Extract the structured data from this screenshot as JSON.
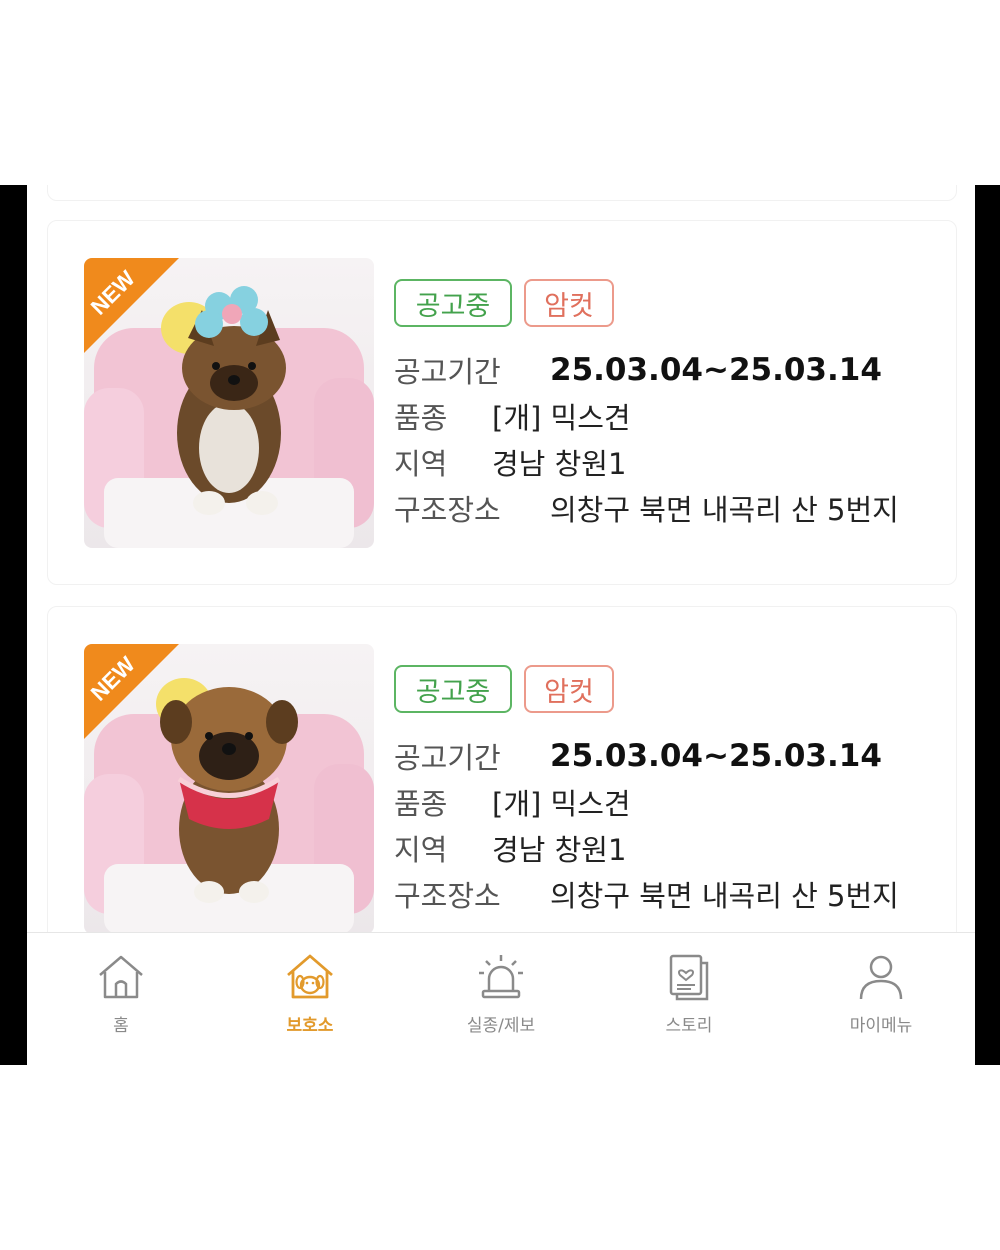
{
  "listings": [
    {
      "badge": "NEW",
      "status": "공고중",
      "sex": "암컷",
      "period_label": "공고기간",
      "period": "25.03.04~25.03.14",
      "breed_label": "품종",
      "breed": "[개] 믹스견",
      "region_label": "지역",
      "region": "경남 창원1",
      "place_label": "구조장소",
      "place": "의창구 북면 내곡리 산 5번지"
    },
    {
      "badge": "NEW",
      "status": "공고중",
      "sex": "암컷",
      "period_label": "공고기간",
      "period": "25.03.04~25.03.14",
      "breed_label": "품종",
      "breed": "[개] 믹스견",
      "region_label": "지역",
      "region": "경남 창원1",
      "place_label": "구조장소",
      "place": "의창구 북면 내곡리 산 5번지"
    }
  ],
  "nav": {
    "items": [
      {
        "label": "홈",
        "icon": "home-icon"
      },
      {
        "label": "보호소",
        "icon": "shelter-icon"
      },
      {
        "label": "실종/제보",
        "icon": "siren-icon"
      },
      {
        "label": "스토리",
        "icon": "story-icon"
      },
      {
        "label": "마이메뉴",
        "icon": "person-icon"
      }
    ],
    "active": "보호소"
  },
  "colors": {
    "status_green": "#43a24c",
    "sex_red": "#e0705d",
    "new_ribbon": "#f08a1c",
    "nav_active": "#e29a2c",
    "nav_inactive": "#8a8a8a"
  }
}
